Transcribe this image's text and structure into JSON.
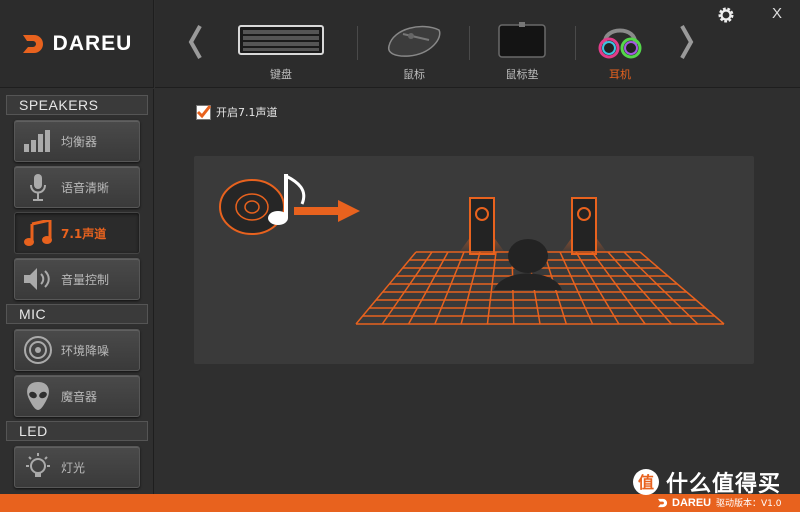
{
  "brand": {
    "name": "DAREU"
  },
  "devices": [
    {
      "label": "键盘",
      "icon": "keyboard-icon"
    },
    {
      "label": "鼠标",
      "icon": "mouse-icon"
    },
    {
      "label": "鼠标垫",
      "icon": "mousepad-icon"
    },
    {
      "label": "耳机",
      "icon": "headset-icon",
      "active": true
    }
  ],
  "sidebar": {
    "sections": [
      {
        "title": "SPEAKERS"
      },
      {
        "title": "MIC"
      },
      {
        "title": "LED"
      }
    ],
    "items": [
      {
        "label": "均衡器",
        "icon": "equalizer-icon"
      },
      {
        "label": "语音清晰",
        "icon": "microphone-icon"
      },
      {
        "label": "7.1声道",
        "icon": "music-note-icon",
        "active": true
      },
      {
        "label": "音量控制",
        "icon": "speaker-volume-icon"
      },
      {
        "label": "环境降噪",
        "icon": "noise-reduction-icon"
      },
      {
        "label": "魔音器",
        "icon": "alien-icon"
      },
      {
        "label": "灯光",
        "icon": "light-bulb-icon"
      }
    ]
  },
  "main": {
    "surround_label": "开启7.1声道",
    "surround_checked": true
  },
  "footer": {
    "brand": "DAREU",
    "version": "驱动版本：V1.0"
  },
  "watermark": {
    "text": "什么值得买"
  },
  "colors": {
    "accent": "#e8621e",
    "background": "#2f2f2f",
    "panel": "#3a3a3a"
  }
}
